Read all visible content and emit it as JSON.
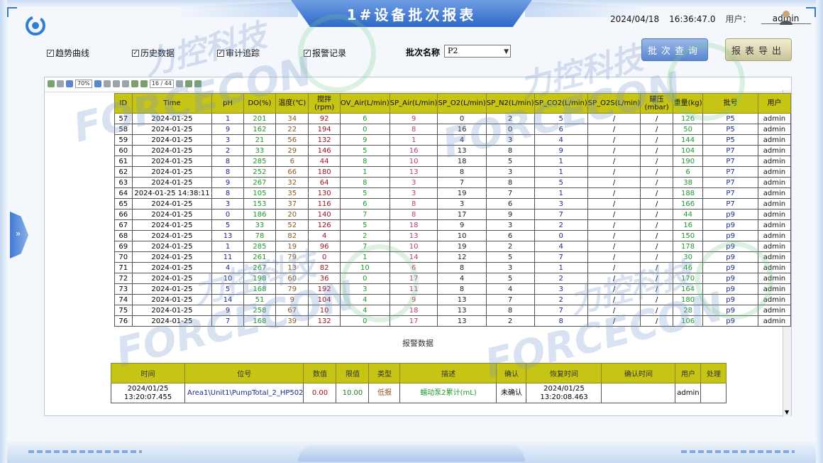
{
  "window": {
    "title": "1#设备批次报表"
  },
  "header": {
    "date": "2024/04/18",
    "time": "16:36:47.0",
    "user_label": "用户：",
    "user": "admin"
  },
  "options": {
    "trend": "趋势曲线",
    "history": "历史数据",
    "audit": "审计追踪",
    "alarm": "报警记录"
  },
  "batch": {
    "label": "批次名称",
    "value": "P2"
  },
  "buttons": {
    "query": "批次查询",
    "export": "报表导出"
  },
  "toolbar": {
    "zoom": "70%",
    "page": "16 / 44"
  },
  "table": {
    "headers": [
      "ID",
      "Time",
      "pH",
      "DO(%)",
      "温度(℃)",
      "搅拌(rpm)",
      "OV_Air(L/min)",
      "SP_Air(L/min)",
      "SP_O2(L/min)",
      "SP_N2(L/min)",
      "SP_CO2(L/min)",
      "SP_O2S(L/min)",
      "罐压(mbar)",
      "重量(kg)",
      "批号",
      "用户"
    ],
    "rows": [
      [
        "57",
        "2024-01-25",
        "1",
        "201",
        "34",
        "92",
        "6",
        "9",
        "0",
        "2",
        "5",
        "/",
        "/",
        "126",
        "P5",
        "admin"
      ],
      [
        "58",
        "2024-01-25",
        "9",
        "162",
        "22",
        "194",
        "0",
        "8",
        "16",
        "0",
        "6",
        "/",
        "/",
        "50",
        "P5",
        "admin"
      ],
      [
        "59",
        "2024-01-25",
        "3",
        "21",
        "56",
        "132",
        "9",
        "1",
        "4",
        "3",
        "4",
        "/",
        "/",
        "144",
        "P5",
        "admin"
      ],
      [
        "60",
        "2024-01-25",
        "2",
        "33",
        "29",
        "146",
        "5",
        "16",
        "13",
        "8",
        "9",
        "/",
        "/",
        "104",
        "P7",
        "admin"
      ],
      [
        "61",
        "2024-01-25",
        "8",
        "285",
        "6",
        "44",
        "8",
        "10",
        "18",
        "5",
        "1",
        "/",
        "/",
        "190",
        "P7",
        "admin"
      ],
      [
        "62",
        "2024-01-25",
        "8",
        "252",
        "66",
        "180",
        "1",
        "13",
        "8",
        "3",
        "1",
        "/",
        "/",
        "6",
        "P7",
        "admin"
      ],
      [
        "63",
        "2024-01-25",
        "9",
        "267",
        "32",
        "64",
        "8",
        "3",
        "7",
        "8",
        "5",
        "/",
        "/",
        "38",
        "P7",
        "admin"
      ],
      [
        "64",
        "2024-01-25 14:38:11",
        "8",
        "105",
        "35",
        "130",
        "5",
        "3",
        "19",
        "7",
        "1",
        "/",
        "/",
        "188",
        "P7",
        "admin"
      ],
      [
        "65",
        "2024-01-25",
        "3",
        "153",
        "37",
        "116",
        "6",
        "8",
        "3",
        "6",
        "3",
        "/",
        "/",
        "166",
        "P7",
        "admin"
      ],
      [
        "66",
        "2024-01-25",
        "0",
        "186",
        "20",
        "140",
        "7",
        "8",
        "17",
        "9",
        "7",
        "/",
        "/",
        "44",
        "p9",
        "admin"
      ],
      [
        "67",
        "2024-01-25",
        "5",
        "33",
        "52",
        "126",
        "5",
        "18",
        "9",
        "3",
        "2",
        "/",
        "/",
        "16",
        "p9",
        "admin"
      ],
      [
        "68",
        "2024-01-25",
        "13",
        "78",
        "82",
        "4",
        "2",
        "13",
        "10",
        "6",
        "0",
        "/",
        "/",
        "150",
        "p9",
        "admin"
      ],
      [
        "69",
        "2024-01-25",
        "1",
        "285",
        "19",
        "96",
        "7",
        "10",
        "19",
        "2",
        "4",
        "/",
        "/",
        "178",
        "p9",
        "admin"
      ],
      [
        "70",
        "2024-01-25",
        "11",
        "261",
        "79",
        "0",
        "1",
        "14",
        "12",
        "5",
        "7",
        "/",
        "/",
        "30",
        "p9",
        "admin"
      ],
      [
        "71",
        "2024-01-25",
        "4",
        "267",
        "13",
        "82",
        "10",
        "6",
        "8",
        "3",
        "1",
        "/",
        "/",
        "46",
        "p9",
        "admin"
      ],
      [
        "72",
        "2024-01-25",
        "10",
        "198",
        "60",
        "36",
        "0",
        "17",
        "4",
        "5",
        "2",
        "/",
        "/",
        "170",
        "p9",
        "admin"
      ],
      [
        "73",
        "2024-01-25",
        "5",
        "168",
        "79",
        "192",
        "3",
        "11",
        "8",
        "4",
        "3",
        "/",
        "/",
        "164",
        "p9",
        "admin"
      ],
      [
        "74",
        "2024-01-25",
        "14",
        "51",
        "9",
        "104",
        "4",
        "9",
        "13",
        "7",
        "2",
        "/",
        "/",
        "180",
        "p9",
        "admin"
      ],
      [
        "75",
        "2024-01-25",
        "9",
        "258",
        "67",
        "10",
        "4",
        "18",
        "13",
        "8",
        "7",
        "/",
        "/",
        "28",
        "p9",
        "admin"
      ],
      [
        "76",
        "2024-01-25",
        "7",
        "168",
        "39",
        "132",
        "0",
        "17",
        "13",
        "2",
        "8",
        "/",
        "/",
        "106",
        "p9",
        "admin"
      ]
    ]
  },
  "alarm": {
    "title": "报警数据",
    "headers": [
      "时间",
      "位号",
      "数值",
      "限值",
      "类型",
      "描述",
      "确认",
      "恢复时间",
      "确认时间",
      "用户",
      "处理"
    ],
    "row": {
      "time": "2024/01/25 13:20:07.455",
      "tag": "Area1\\Unit1\\PumpTotal_2_HP502",
      "value": "0.00",
      "limit": "10.00",
      "type": "低报",
      "desc": "蠕动泵2累计(mL)",
      "confirm": "未确认",
      "recover_time": "2024/01/25 13:20:08.463",
      "confirm_time": "",
      "user": "admin",
      "handle": ""
    }
  },
  "watermark": {
    "cn": "力控科技",
    "en": "FORCECON"
  }
}
